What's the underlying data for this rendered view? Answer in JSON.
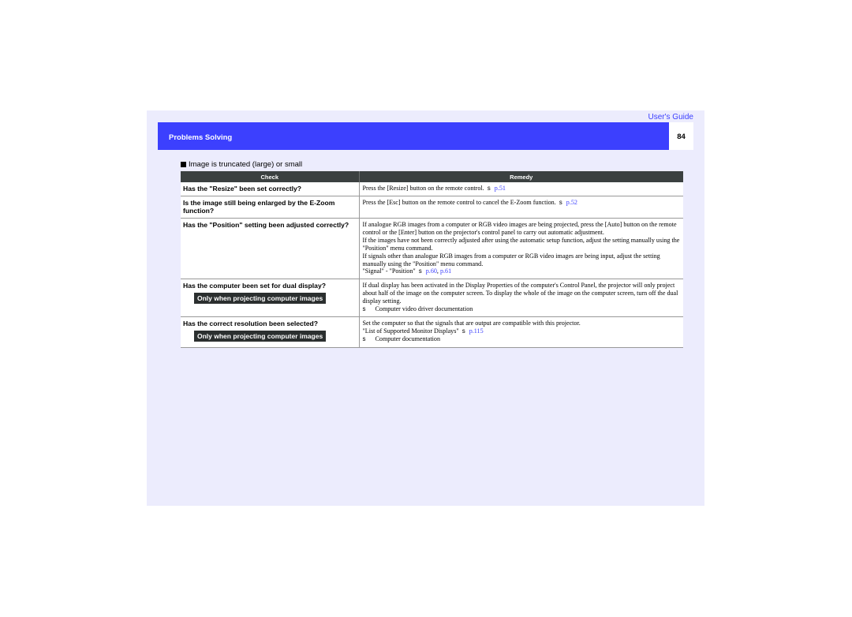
{
  "header": {
    "guide_link": "User's Guide",
    "section_title": "Problems Solving",
    "page_number": "84",
    "brand_color": "#3C40FE"
  },
  "section": {
    "heading": "Image is truncated (large) or small"
  },
  "table": {
    "columns": [
      "Check",
      "Remedy"
    ],
    "rows": [
      {
        "check": "Has the \"Resize\" been set correctly?",
        "remedy": {
          "lines": [
            {
              "text": "Press the [Resize] button on the remote control.",
              "arrow": "s",
              "links": [
                "p.51"
              ]
            }
          ]
        }
      },
      {
        "check": "Is the image still being enlarged by the E-Zoom function?",
        "remedy": {
          "lines": [
            {
              "text": "Press the [Esc] button on the remote control to cancel the E-Zoom function.",
              "arrow": "s",
              "links": [
                "p.52"
              ]
            }
          ]
        }
      },
      {
        "check": "Has the \"Position\" setting been adjusted correctly?",
        "remedy": {
          "lines": [
            {
              "text": "If analogue RGB images from a computer or RGB video images are being projected, press the [Auto] button on the remote control or the [Enter] button on the projector's control panel to carry out automatic adjustment."
            },
            {
              "text": "If the images have not been correctly adjusted after using the automatic setup function, adjust the setting manually using the \"Position\" menu command."
            },
            {
              "text": "If signals other than analogue RGB images from a computer or RGB video images are being input, adjust the setting manually using the \"Position\" menu command."
            },
            {
              "text": "\"Signal\" - \"Position\"",
              "arrow": "s",
              "links": [
                "p.60",
                "p.61"
              ]
            }
          ]
        }
      },
      {
        "check": "Has the computer been set for dual display?",
        "badge": "Only when projecting computer images",
        "remedy": {
          "lines": [
            {
              "text": "If dual display has been activated in the Display Properties of the computer's Control Panel, the projector will only project about half of the image on the computer screen. To display the whole of the image on the computer screen, turn off the dual display setting."
            },
            {
              "lead_arrow": "s",
              "text": "Computer video driver documentation"
            }
          ]
        }
      },
      {
        "check": "Has the correct resolution been selected?",
        "badge": "Only when projecting computer images",
        "remedy": {
          "lines": [
            {
              "text": "Set the computer so that the signals that are output are compatible with this projector."
            },
            {
              "text": "\"List of Supported Monitor Displays\"",
              "arrow": "s",
              "links": [
                "p.115"
              ]
            },
            {
              "lead_arrow": "s",
              "text": "Computer documentation"
            }
          ]
        }
      }
    ]
  }
}
